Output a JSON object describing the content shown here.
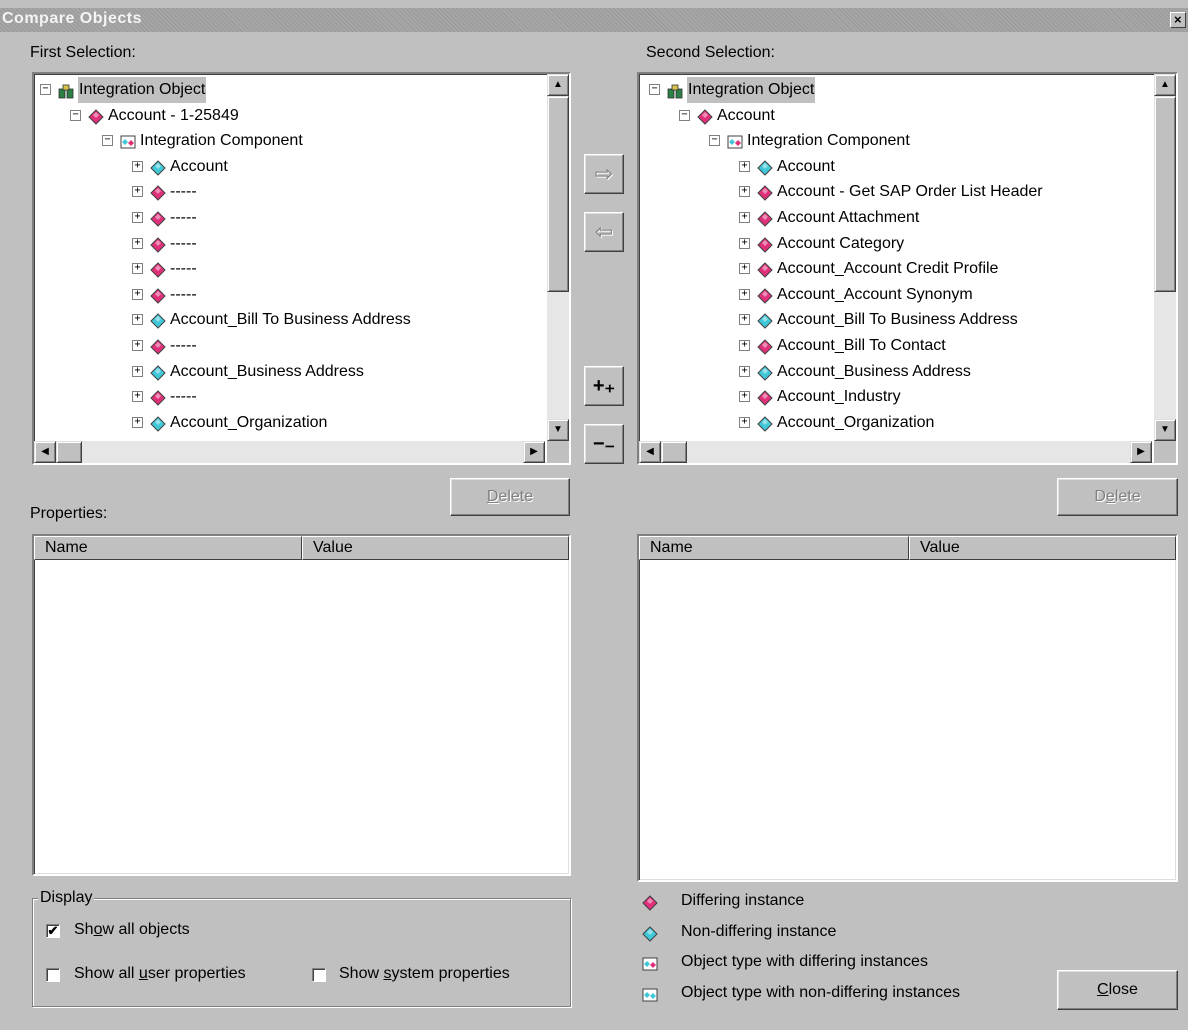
{
  "window": {
    "title": "Compare Objects",
    "close_glyph": "×"
  },
  "left": {
    "label": "First Selection:",
    "tree": [
      {
        "text": "Integration Object",
        "level": 0,
        "icon": "integration-object-icon",
        "expander": "−",
        "selected": true
      },
      {
        "text": "Account - 1-25849",
        "level": 1,
        "icon": "differing-instance-icon",
        "expander": "−"
      },
      {
        "text": "Integration Component",
        "level": 2,
        "icon": "object-type-differing-icon",
        "expander": "−"
      },
      {
        "text": "Account",
        "level": 3,
        "icon": "non-differing-instance-icon",
        "expander": "+"
      },
      {
        "text": "-----",
        "level": 3,
        "icon": "differing-instance-icon",
        "expander": "+"
      },
      {
        "text": "-----",
        "level": 3,
        "icon": "differing-instance-icon",
        "expander": "+"
      },
      {
        "text": "-----",
        "level": 3,
        "icon": "differing-instance-icon",
        "expander": "+"
      },
      {
        "text": "-----",
        "level": 3,
        "icon": "differing-instance-icon",
        "expander": "+"
      },
      {
        "text": "-----",
        "level": 3,
        "icon": "differing-instance-icon",
        "expander": "+"
      },
      {
        "text": "Account_Bill To Business Address",
        "level": 3,
        "icon": "non-differing-instance-icon",
        "expander": "+"
      },
      {
        "text": "-----",
        "level": 3,
        "icon": "differing-instance-icon",
        "expander": "+"
      },
      {
        "text": "Account_Business Address",
        "level": 3,
        "icon": "non-differing-instance-icon",
        "expander": "+"
      },
      {
        "text": "-----",
        "level": 3,
        "icon": "differing-instance-icon",
        "expander": "+"
      },
      {
        "text": "Account_Organization",
        "level": 3,
        "icon": "non-differing-instance-icon",
        "expander": "+"
      }
    ],
    "delete_label": "Delete",
    "delete_accel": "D",
    "properties_label": "Properties:",
    "columns": [
      "Name",
      "Value"
    ]
  },
  "right": {
    "label": "Second Selection:",
    "tree": [
      {
        "text": "Integration Object",
        "level": 0,
        "icon": "integration-object-icon",
        "expander": "−",
        "selected": true
      },
      {
        "text": "Account",
        "level": 1,
        "icon": "differing-instance-icon",
        "expander": "−"
      },
      {
        "text": "Integration Component",
        "level": 2,
        "icon": "object-type-differing-icon",
        "expander": "−"
      },
      {
        "text": "Account",
        "level": 3,
        "icon": "non-differing-instance-icon",
        "expander": "+"
      },
      {
        "text": "Account - Get SAP Order List Header",
        "level": 3,
        "icon": "differing-instance-icon",
        "expander": "+"
      },
      {
        "text": "Account Attachment",
        "level": 3,
        "icon": "differing-instance-icon",
        "expander": "+"
      },
      {
        "text": "Account Category",
        "level": 3,
        "icon": "differing-instance-icon",
        "expander": "+"
      },
      {
        "text": "Account_Account Credit Profile",
        "level": 3,
        "icon": "differing-instance-icon",
        "expander": "+"
      },
      {
        "text": "Account_Account Synonym",
        "level": 3,
        "icon": "differing-instance-icon",
        "expander": "+"
      },
      {
        "text": "Account_Bill To Business Address",
        "level": 3,
        "icon": "non-differing-instance-icon",
        "expander": "+"
      },
      {
        "text": "Account_Bill To Contact",
        "level": 3,
        "icon": "differing-instance-icon",
        "expander": "+"
      },
      {
        "text": "Account_Business Address",
        "level": 3,
        "icon": "non-differing-instance-icon",
        "expander": "+"
      },
      {
        "text": "Account_Industry",
        "level": 3,
        "icon": "differing-instance-icon",
        "expander": "+"
      },
      {
        "text": "Account_Organization",
        "level": 3,
        "icon": "non-differing-instance-icon",
        "expander": "+"
      }
    ],
    "delete_label": "Delete",
    "delete_accel": "e",
    "columns": [
      "Name",
      "Value"
    ]
  },
  "middle": {
    "copy_right_glyph": "⇨",
    "copy_left_glyph": "⇦",
    "expand_all_glyph": "+₊",
    "collapse_all_glyph": "−₋"
  },
  "display": {
    "title": "Display",
    "show_all_objects": {
      "label": "Show all objects",
      "checked": true
    },
    "show_all_user_properties": {
      "label": "Show all user properties",
      "checked": false
    },
    "show_system_properties": {
      "label": "Show system properties",
      "checked": false
    }
  },
  "legend": [
    {
      "icon": "differing-instance-icon",
      "label": "Differing instance"
    },
    {
      "icon": "non-differing-instance-icon",
      "label": "Non-differing instance"
    },
    {
      "icon": "object-type-differing-icon",
      "label": "Object type with differing instances"
    },
    {
      "icon": "object-type-non-differing-icon",
      "label": "Object type with non-differing instances"
    }
  ],
  "close_label": "Close",
  "colors": {
    "differing": "#e0307a",
    "non_differing": "#40c8d8",
    "face": "#c0c0c0",
    "selection": "#c0c0c0"
  }
}
